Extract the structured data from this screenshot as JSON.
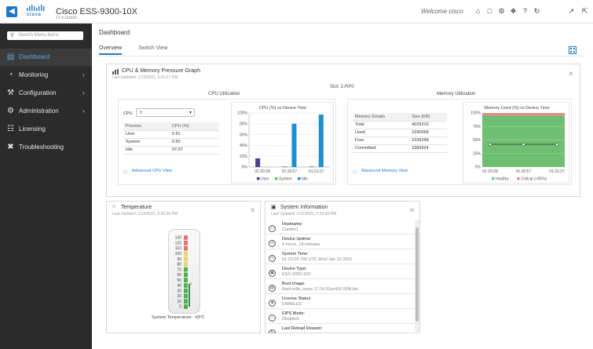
{
  "header": {
    "logo_text": "cisco",
    "device_title": "Cisco ESS-9300-10X",
    "device_version": "17.4.1prd16",
    "welcome": "Welcome cisco",
    "icons": [
      "home-icon",
      "save-icon",
      "gear-icon",
      "wrench-icon",
      "help-icon",
      "refresh-icon",
      "expand-icon",
      "fullscreen-icon"
    ],
    "accent": "#1d79c9"
  },
  "sidebar": {
    "search_placeholder": "Search Menu Items",
    "items": [
      {
        "label": "Dashboard",
        "icon": "dashboard-icon",
        "active": true,
        "chevron": false
      },
      {
        "label": "Monitoring",
        "icon": "monitoring-icon",
        "active": false,
        "chevron": true
      },
      {
        "label": "Configuration",
        "icon": "configuration-icon",
        "active": false,
        "chevron": true
      },
      {
        "label": "Administration",
        "icon": "administration-icon",
        "active": false,
        "chevron": true
      },
      {
        "label": "Licensing",
        "icon": "licensing-icon",
        "active": false,
        "chevron": false
      },
      {
        "label": "Troubleshooting",
        "icon": "troubleshooting-icon",
        "active": false,
        "chevron": false
      }
    ]
  },
  "main": {
    "title": "Dashboard",
    "tabs": [
      {
        "label": "Overview",
        "active": true
      },
      {
        "label": "Switch View",
        "active": false
      }
    ]
  },
  "cpu_mem_panel": {
    "title": "CPU & Memory Pressure Graph",
    "last_updated": "Last Updated: 1/12/2021, 5:21:27 PM",
    "slot": "Slot: 1-RP0",
    "cpu": {
      "section_title": "CPU Utilization",
      "select_label": "CPU",
      "select_value": "0",
      "table_headers": [
        "Process",
        "CPU (%)"
      ],
      "rows": [
        [
          "User",
          "0.91"
        ],
        [
          "System",
          "0.50"
        ],
        [
          "Idle",
          "97.07"
        ]
      ],
      "link": "Advanced CPU View"
    },
    "memory": {
      "section_title": "Memory Utilization",
      "table_headers": [
        "Memory Details",
        "Size (KB)"
      ],
      "rows": [
        [
          "Total",
          "4029316"
        ],
        [
          "Used",
          "1690068"
        ],
        [
          "Free",
          "2339248"
        ],
        [
          "Committed",
          "2383924"
        ]
      ],
      "link": "Advanced Memory View"
    }
  },
  "temperature_panel": {
    "title": "Temperature",
    "last_updated": "Last Updated: 1/12/2021, 5:20:30 PM",
    "scale": [
      "130",
      "120",
      "110",
      "100",
      "90",
      "80",
      "70",
      "60",
      "50",
      "40",
      "30",
      "20",
      "10",
      "0"
    ],
    "reading_label": "System Temperature : 43ºC",
    "value": 43
  },
  "system_panel": {
    "title": "System Information",
    "last_updated": "Last Updated: 1/12/2021, 5:20:30 PM",
    "items": [
      {
        "key": "Hostname:",
        "value": "Condor1",
        "icon": "hostname-icon"
      },
      {
        "key": "Device Uptime:",
        "value": "5 hours, 18 minutes",
        "icon": "uptime-icon"
      },
      {
        "key": "System Time:",
        "value": "01:20:29.765 UTC Wed Jan 13 2021",
        "icon": "clock-icon"
      },
      {
        "key": "Device Type:",
        "value": "ESS-9300-10X",
        "icon": "device-icon"
      },
      {
        "key": "Boot Image:",
        "value": "flash:ie9k_iosxe.17.04.01prd16.SPA.bin",
        "icon": "boot-icon"
      },
      {
        "key": "License Status:",
        "value": "ENABLED",
        "icon": "license-icon"
      },
      {
        "key": "FIPS Mode:",
        "value": "Disabled",
        "icon": "fips-icon"
      },
      {
        "key": "Last Reload Reason:",
        "value": "",
        "icon": "reload-icon"
      }
    ]
  },
  "chart_data": [
    {
      "type": "bar",
      "title": "CPU (%) vs Device Time",
      "categories": [
        "01:20:28",
        "01:20:57",
        "01:21:27"
      ],
      "series": [
        {
          "name": "User",
          "values": [
            16,
            0.9,
            0.9
          ],
          "color": "#4b3f8a"
        },
        {
          "name": "System",
          "values": [
            0.5,
            0.5,
            0.5
          ],
          "color": "#6fbf73"
        },
        {
          "name": "Idle",
          "values": [
            0,
            80,
            97
          ],
          "color": "#1d8fd0"
        }
      ],
      "ylim": [
        0,
        100
      ],
      "yticks": [
        "0%",
        "20%",
        "40%",
        "60%",
        "80%",
        "100%"
      ],
      "legend": "bottom"
    },
    {
      "type": "area",
      "title": "Memory Used (%) vs Device Time",
      "categories": [
        "01:20:28",
        "01:20:57",
        "01:21:27"
      ],
      "series": [
        {
          "name": "Healthy",
          "values": [
            42,
            42,
            42
          ],
          "color": "#6fbf73"
        },
        {
          "name": "Critical (>95%)",
          "values": [
            95,
            95,
            95
          ],
          "color": "#e28c8c"
        }
      ],
      "ylim": [
        0,
        100
      ],
      "yticks": [
        "0%",
        "25%",
        "50%",
        "75%",
        "100%"
      ],
      "legend": "bottom"
    }
  ]
}
